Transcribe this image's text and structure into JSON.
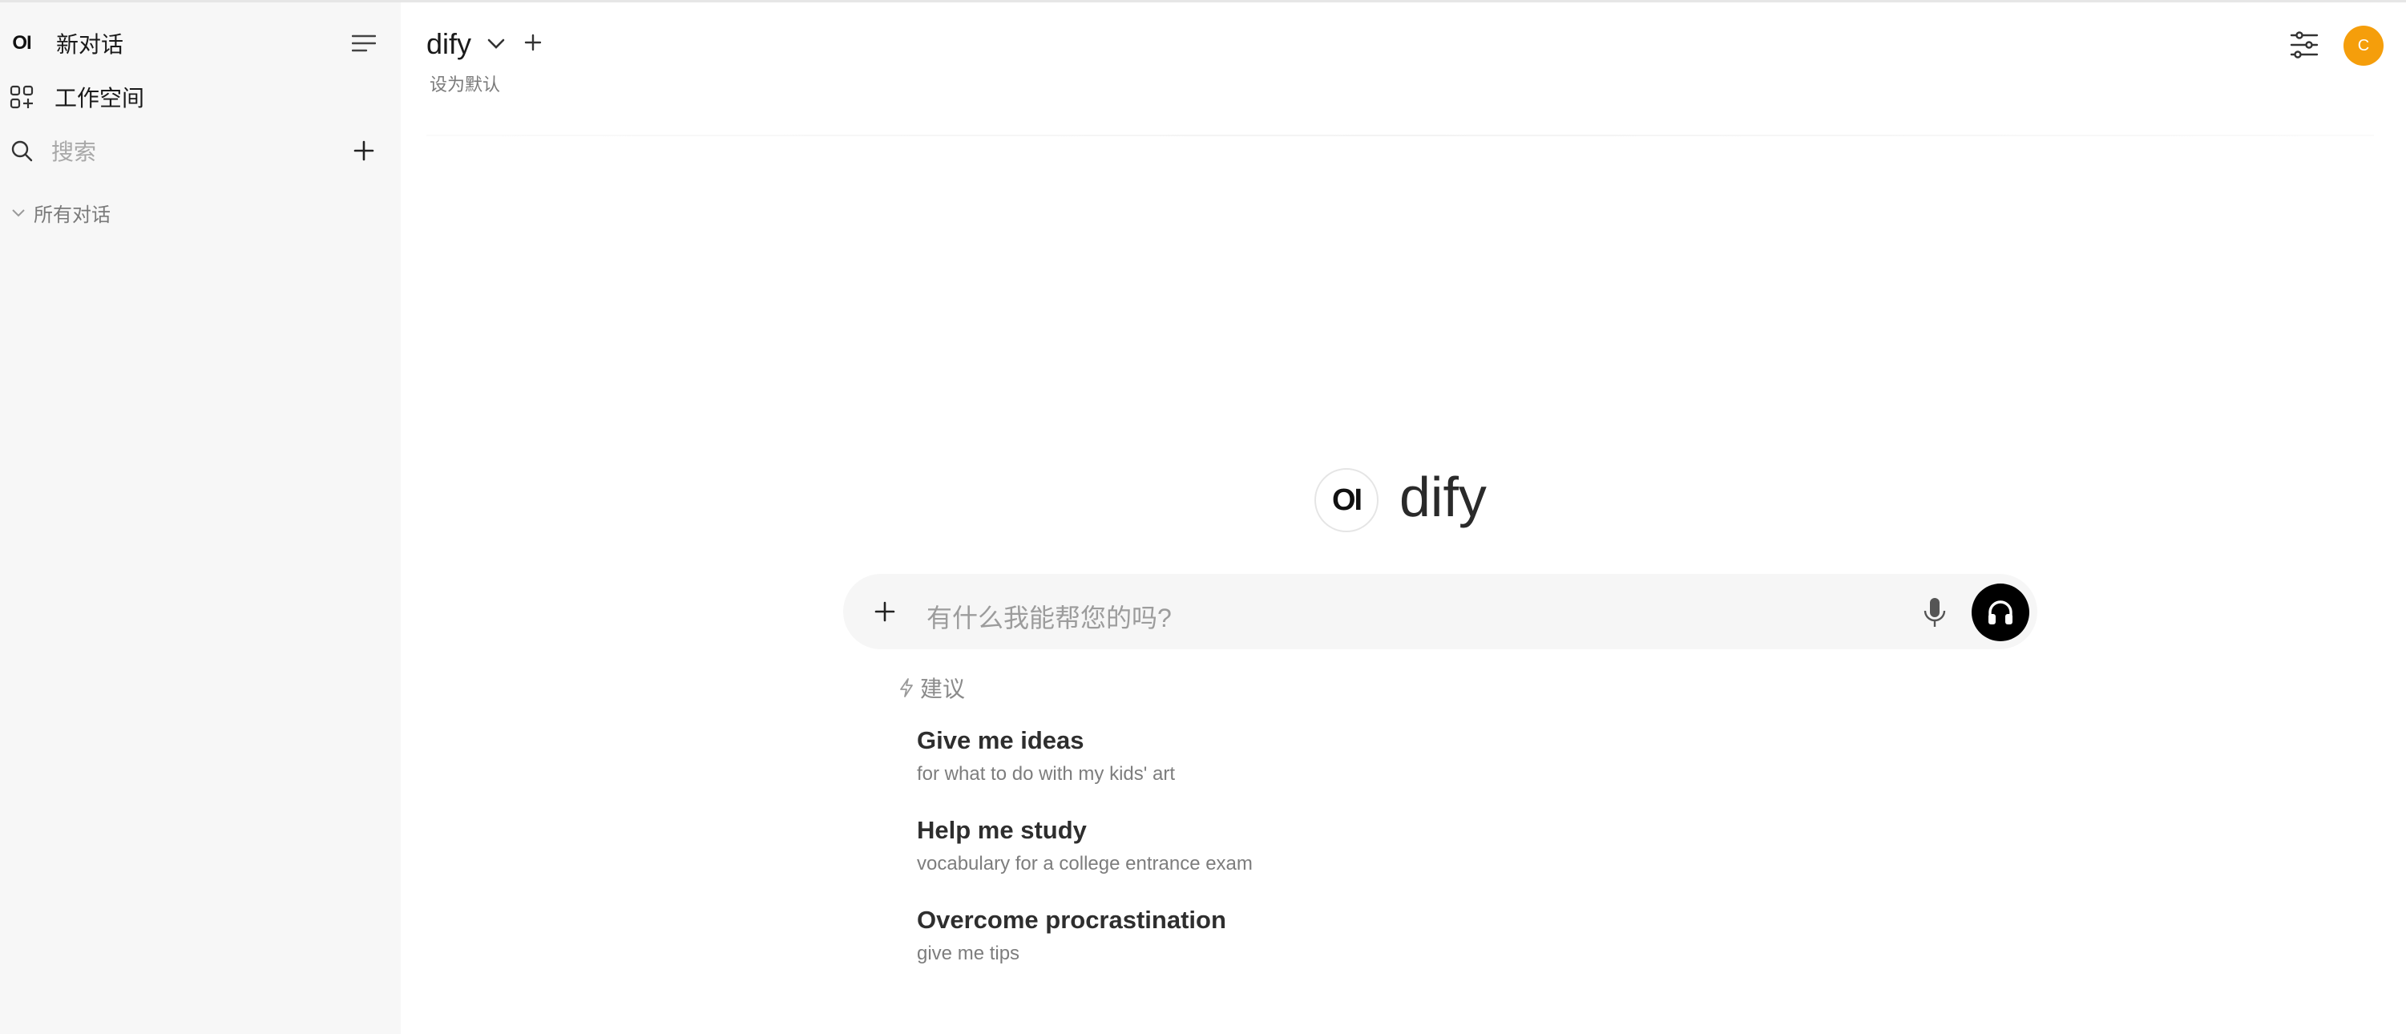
{
  "sidebar": {
    "logo_text": "OI",
    "new_chat_label": "新对话",
    "workspace_label": "工作空间",
    "search_placeholder": "搜索",
    "group_label": "所有对话"
  },
  "header": {
    "model_name": "dify",
    "set_default_label": "设为默认",
    "avatar_initial": "C"
  },
  "hero": {
    "logo_text": "OI",
    "title": "dify"
  },
  "input": {
    "placeholder": "有什么我能帮您的吗?"
  },
  "suggestions": {
    "label": "建议",
    "items": [
      {
        "title": "Give me ideas",
        "subtitle": "for what to do with my kids' art"
      },
      {
        "title": "Help me study",
        "subtitle": "vocabulary for a college entrance exam"
      },
      {
        "title": "Overcome procrastination",
        "subtitle": "give me tips"
      }
    ]
  },
  "colors": {
    "avatar_bg": "#f59e0b",
    "sidebar_bg": "#f7f7f7",
    "voice_button_bg": "#000000"
  }
}
